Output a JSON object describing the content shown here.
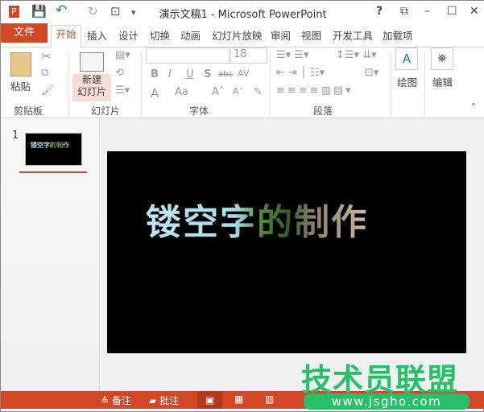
{
  "window": {
    "title": "演示文稿1 - Microsoft PowerPoint",
    "help": "?",
    "minimize": "–",
    "maximize": "☐",
    "close": "✕",
    "restore_ribbon": "⧉"
  },
  "quick_access": {
    "app_icon": "P",
    "save": "💾",
    "undo": "↶",
    "redo": "↻",
    "present": "⊡",
    "customize": "▾"
  },
  "tabs": {
    "file": "文件",
    "items": [
      "开始",
      "插入",
      "设计",
      "切换",
      "动画",
      "幻灯片放映",
      "审阅",
      "视图",
      "开发工具",
      "加载项"
    ]
  },
  "ribbon": {
    "clipboard": {
      "label": "剪贴板",
      "paste": "粘贴"
    },
    "slides": {
      "label": "幻灯片",
      "new_slide_line1": "新建",
      "new_slide_line2": "幻灯片"
    },
    "font": {
      "label": "字体",
      "font_name": "",
      "font_size": "18",
      "bold": "B",
      "italic": "I",
      "underline": "U",
      "shadow": "S",
      "strike": "abc",
      "spacing": "AV",
      "color": "A",
      "case": "Aa",
      "grow": "A˄",
      "shrink": "A˅"
    },
    "paragraph": {
      "label": "段落"
    },
    "drawing": {
      "label": "绘图"
    },
    "editing": {
      "label": "编辑"
    },
    "collapse": "˄"
  },
  "thumbnails": [
    {
      "number": "1",
      "text": "镂空字的制作"
    }
  ],
  "slide": {
    "title": "镂空字的制作"
  },
  "status": {
    "notes": "备注",
    "comments": "批注"
  },
  "watermark": {
    "brand": "技术员联盟",
    "url": "www.jsgho.com"
  },
  "colors": {
    "accent": "#d24726",
    "watermark": "#26c069"
  }
}
